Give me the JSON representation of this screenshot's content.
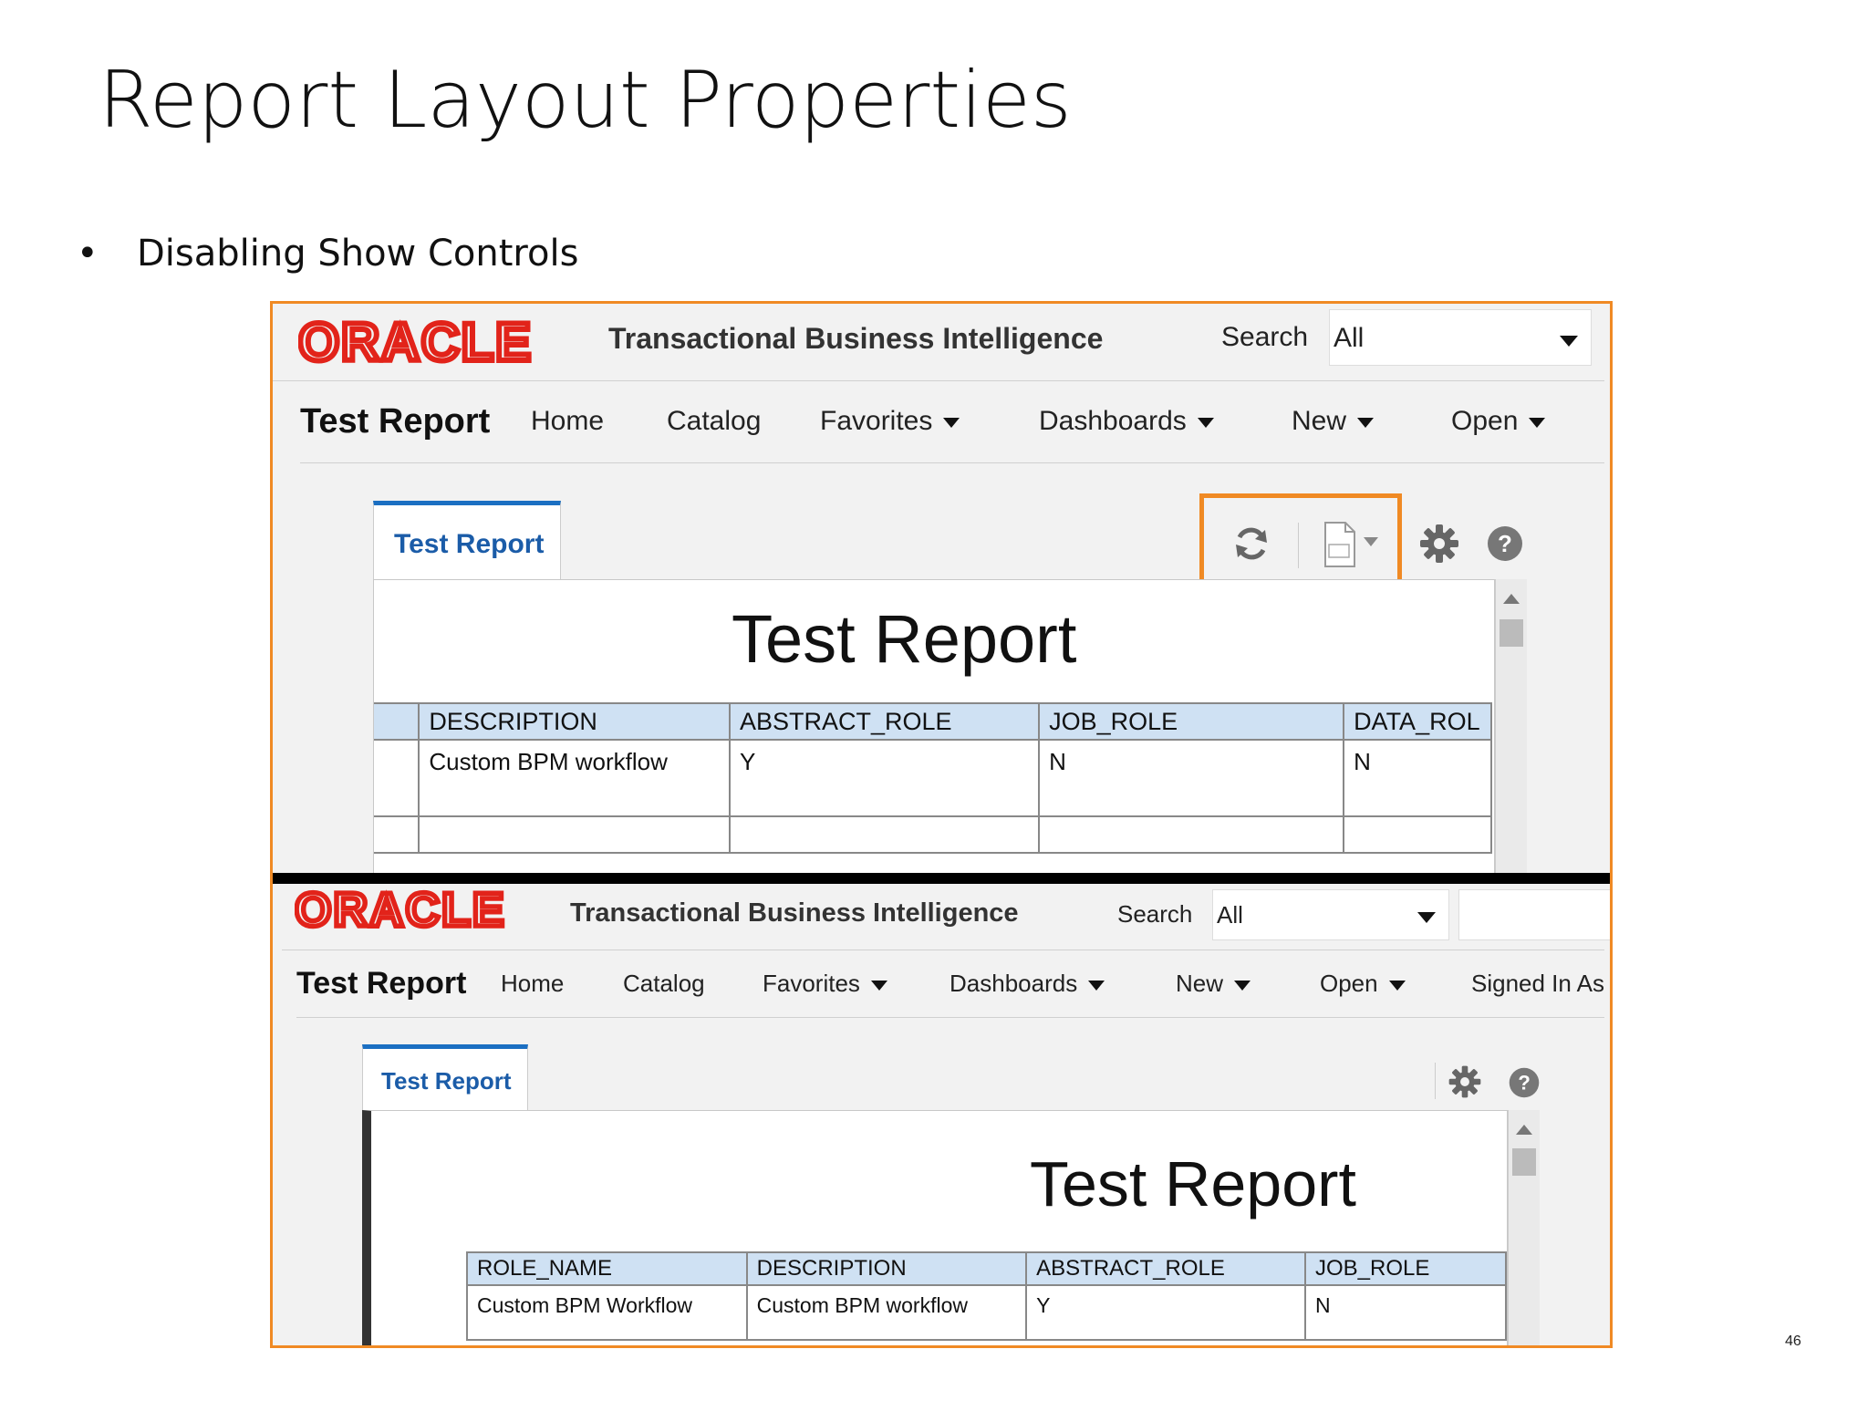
{
  "slide": {
    "title": "Report Layout Properties",
    "bullet": "Disabling Show Controls",
    "page_number": "46"
  },
  "shot1": {
    "logo": "ORACLE",
    "brand": "Transactional Business Intelligence",
    "search_label": "Search",
    "search_value": "All",
    "nav_title": "Test Report",
    "nav": [
      "Home",
      "Catalog",
      "Favorites",
      "Dashboards",
      "New",
      "Open"
    ],
    "tab_label": "Test Report",
    "report_title": "Test Report",
    "columns": [
      "DESCRIPTION",
      "ABSTRACT_ROLE",
      "JOB_ROLE",
      "DATA_ROL"
    ],
    "row1": [
      "Custom BPM workflow",
      "Y",
      "N",
      "N"
    ]
  },
  "shot2": {
    "logo": "ORACLE",
    "brand": "Transactional Business Intelligence",
    "search_label": "Search",
    "search_value": "All",
    "nav_title": "Test Report",
    "nav": [
      "Home",
      "Catalog",
      "Favorites",
      "Dashboards",
      "New",
      "Open",
      "Signed In As"
    ],
    "tab_label": "Test Report",
    "report_title": "Test Report",
    "columns": [
      "ROLE_NAME",
      "DESCRIPTION",
      "ABSTRACT_ROLE",
      "JOB_ROLE"
    ],
    "row1": [
      "Custom BPM Workflow",
      "Custom BPM workflow",
      "Y",
      "N"
    ]
  },
  "colors": {
    "oracle_red": "#e2231a",
    "highlight": "#f08a24",
    "tab_accent": "#1b6fc2",
    "header_fill": "#cfe1f3"
  },
  "icons": [
    "refresh-icon",
    "pdf-export-icon",
    "gear-icon",
    "help-icon"
  ]
}
